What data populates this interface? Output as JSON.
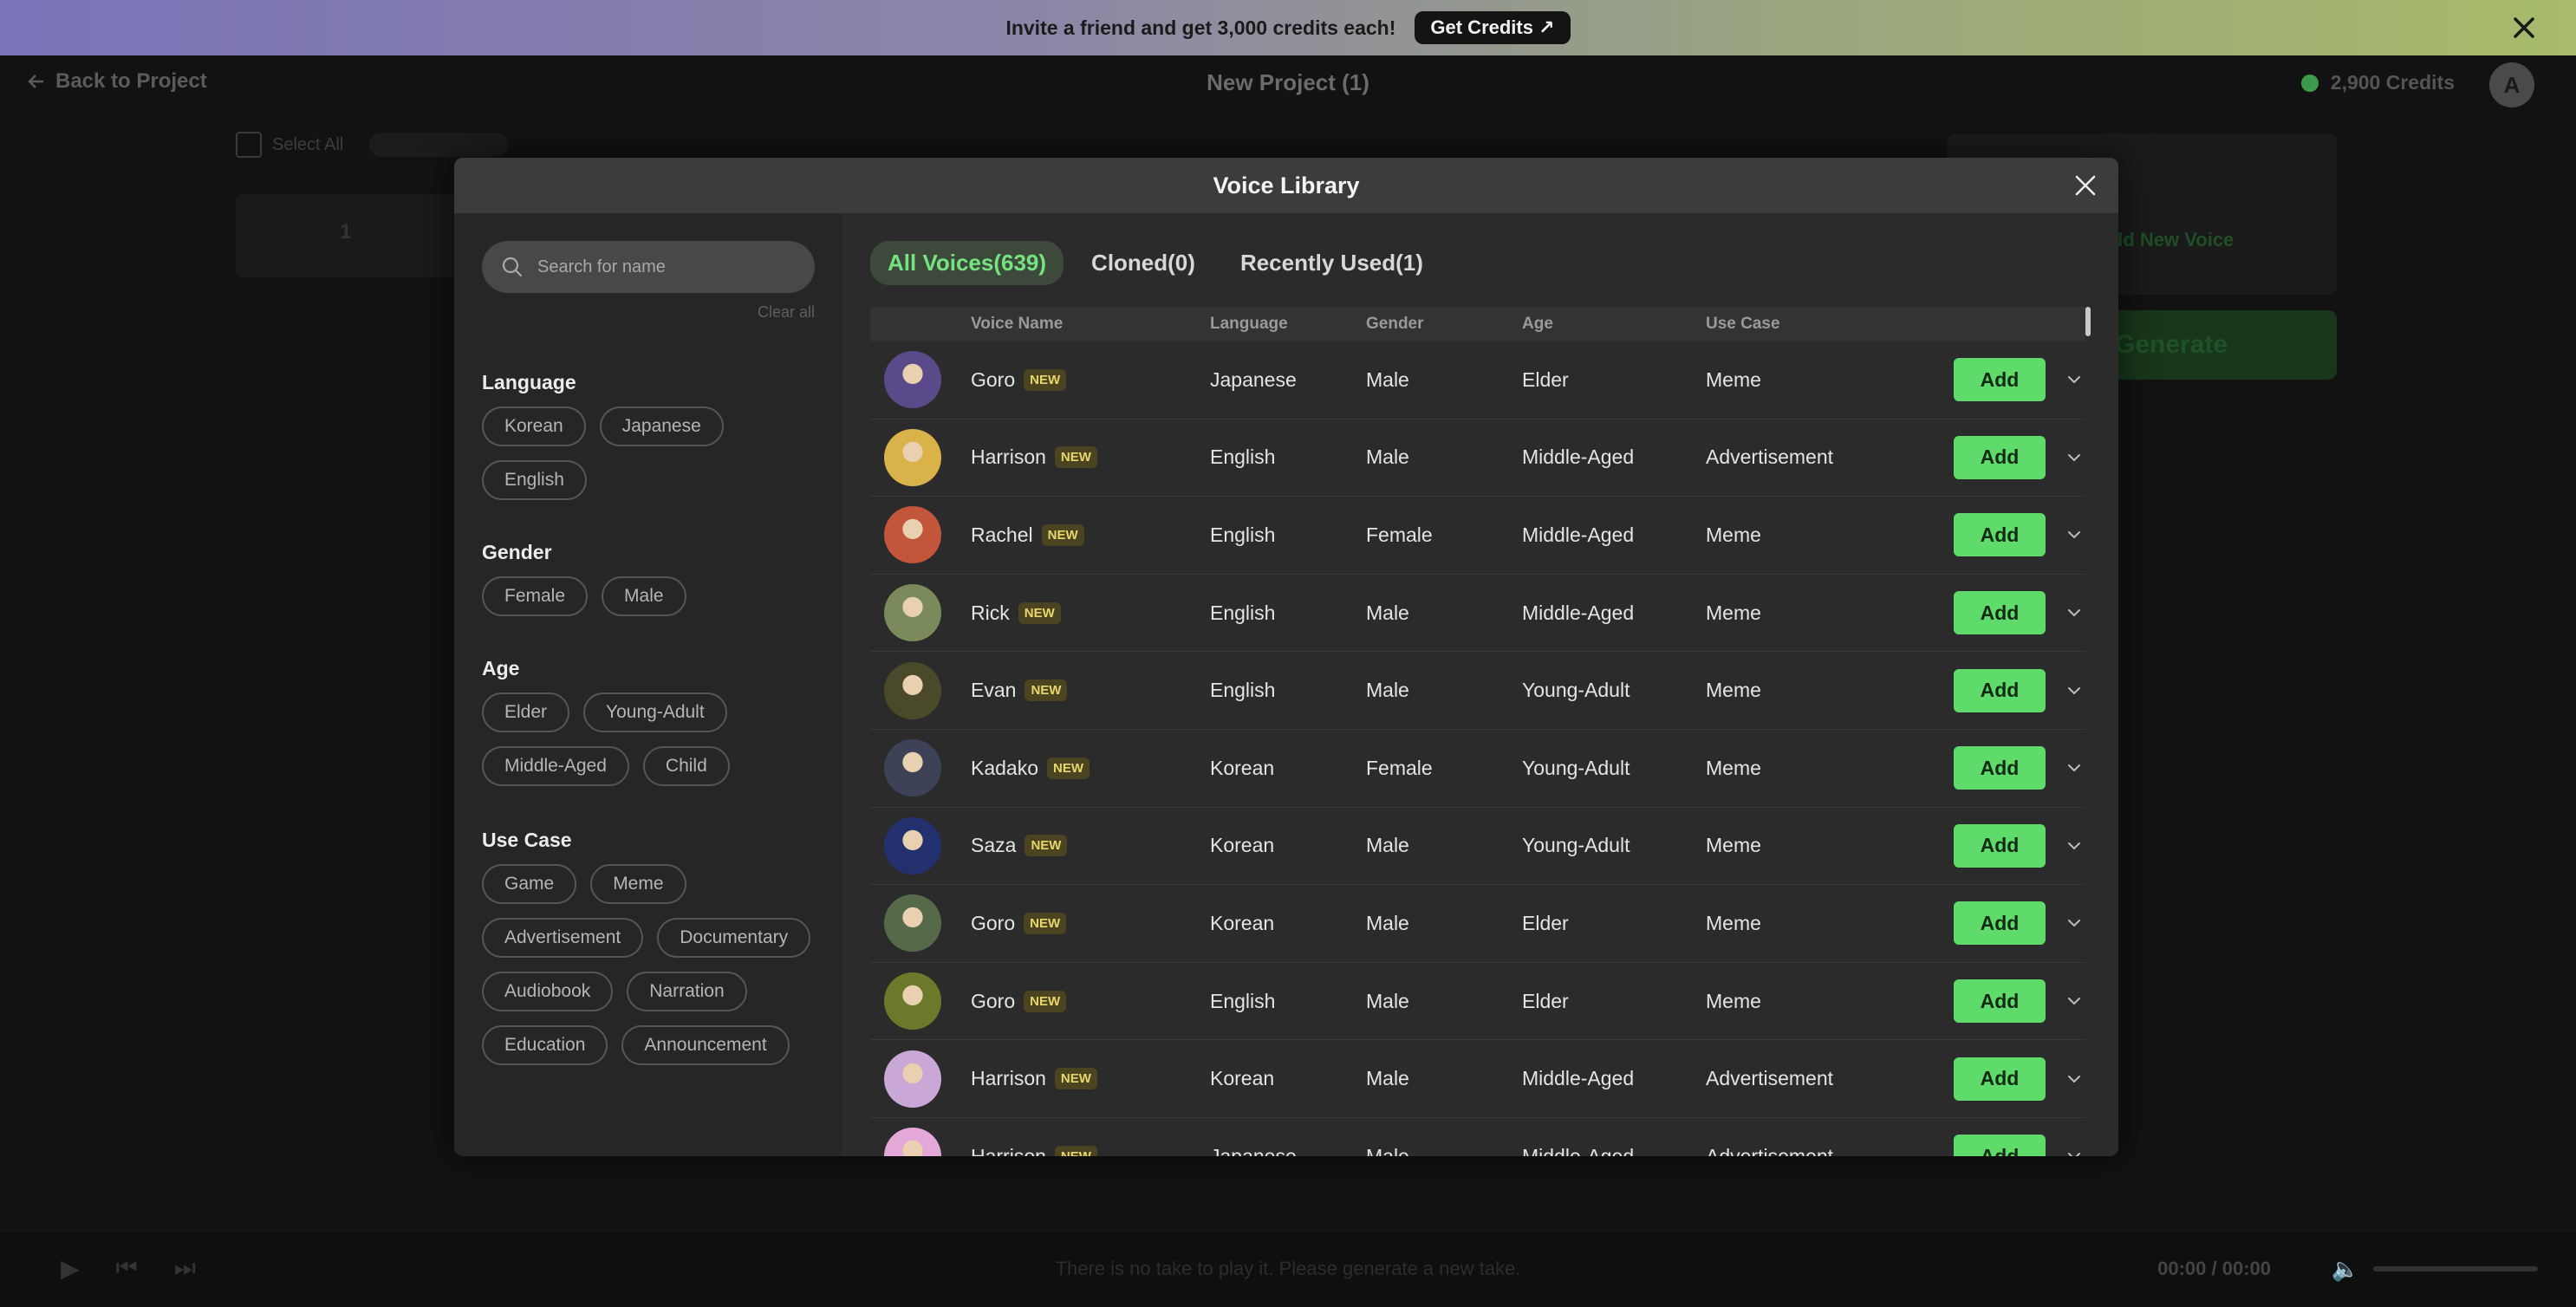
{
  "promo": {
    "text": "Invite a friend and get 3,000 credits each!",
    "button": "Get Credits ↗"
  },
  "topbar": {
    "back": "Back to Project",
    "title": "New Project (1)",
    "credits": "2,900 Credits",
    "avatar_letter": "A"
  },
  "background": {
    "select_all": "Select All",
    "row_number": "1",
    "add_new_voice": "Add New Voice",
    "generate": "Generate"
  },
  "bottombar": {
    "message": "There is no take to play it. Please generate a new take.",
    "time": "00:00 / 00:00"
  },
  "modal": {
    "title": "Voice Library",
    "search_placeholder": "Search for name",
    "clear_all": "Clear all",
    "filters": [
      {
        "title": "Language",
        "options": [
          "Korean",
          "Japanese",
          "English"
        ]
      },
      {
        "title": "Gender",
        "options": [
          "Female",
          "Male"
        ]
      },
      {
        "title": "Age",
        "options": [
          "Elder",
          "Young-Adult",
          "Middle-Aged",
          "Child"
        ]
      },
      {
        "title": "Use Case",
        "options": [
          "Game",
          "Meme",
          "Advertisement",
          "Documentary",
          "Audiobook",
          "Narration",
          "Education",
          "Announcement"
        ]
      }
    ],
    "tabs": [
      "All Voices(639)",
      "Cloned(0)",
      "Recently Used(1)"
    ],
    "columns": [
      "Voice Name",
      "Language",
      "Gender",
      "Age",
      "Use Case"
    ],
    "badge": "NEW",
    "add_label": "Add",
    "rows": [
      {
        "name": "Goro",
        "language": "Japanese",
        "gender": "Male",
        "age": "Elder",
        "use_case": "Meme",
        "avatar_color": "#5b4a8a"
      },
      {
        "name": "Harrison",
        "language": "English",
        "gender": "Male",
        "age": "Middle-Aged",
        "use_case": "Advertisement",
        "avatar_color": "#d9b24a"
      },
      {
        "name": "Rachel",
        "language": "English",
        "gender": "Female",
        "age": "Middle-Aged",
        "use_case": "Meme",
        "avatar_color": "#c2553a"
      },
      {
        "name": "Rick",
        "language": "English",
        "gender": "Male",
        "age": "Middle-Aged",
        "use_case": "Meme",
        "avatar_color": "#7a8a5a"
      },
      {
        "name": "Evan",
        "language": "English",
        "gender": "Male",
        "age": "Young-Adult",
        "use_case": "Meme",
        "avatar_color": "#4a4a2a"
      },
      {
        "name": "Kadako",
        "language": "Korean",
        "gender": "Female",
        "age": "Young-Adult",
        "use_case": "Meme",
        "avatar_color": "#3e4256"
      },
      {
        "name": "Saza",
        "language": "Korean",
        "gender": "Male",
        "age": "Young-Adult",
        "use_case": "Meme",
        "avatar_color": "#23306e"
      },
      {
        "name": "Goro",
        "language": "Korean",
        "gender": "Male",
        "age": "Elder",
        "use_case": "Meme",
        "avatar_color": "#566a4a"
      },
      {
        "name": "Goro",
        "language": "English",
        "gender": "Male",
        "age": "Elder",
        "use_case": "Meme",
        "avatar_color": "#6a7a2a"
      },
      {
        "name": "Harrison",
        "language": "Korean",
        "gender": "Male",
        "age": "Middle-Aged",
        "use_case": "Advertisement",
        "avatar_color": "#c9a8d8"
      },
      {
        "name": "Harrison",
        "language": "Japanese",
        "gender": "Male",
        "age": "Middle-Aged",
        "use_case": "Advertisement",
        "avatar_color": "#e4a8d8"
      }
    ]
  }
}
